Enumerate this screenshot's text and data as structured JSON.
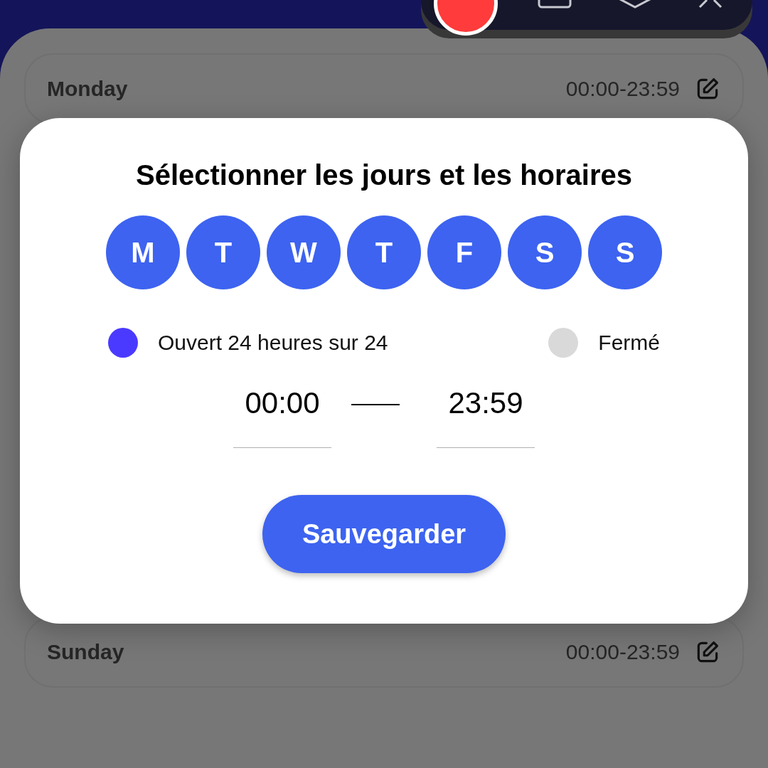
{
  "schedule": [
    {
      "day": "Monday",
      "hours": "00:00-23:59"
    },
    {
      "day": "Sunday",
      "hours": "00:00-23:59"
    }
  ],
  "dialog": {
    "title": "Sélectionner les jours et les horaires",
    "days": [
      {
        "label": "M",
        "selected": true
      },
      {
        "label": "T",
        "selected": true
      },
      {
        "label": "W",
        "selected": true
      },
      {
        "label": "T",
        "selected": true
      },
      {
        "label": "F",
        "selected": true
      },
      {
        "label": "S",
        "selected": true
      },
      {
        "label": "S",
        "selected": true
      }
    ],
    "options": [
      {
        "label": "Ouvert 24 heures sur 24",
        "selected": true
      },
      {
        "label": "Fermé",
        "selected": false
      }
    ],
    "start_time": "00:00",
    "end_time": "23:59",
    "save_button": "Sauvegarder"
  }
}
